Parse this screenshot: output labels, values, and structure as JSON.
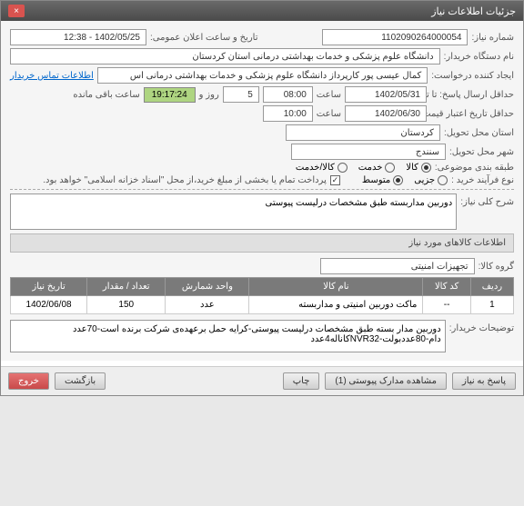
{
  "window": {
    "title": "جزئیات اطلاعات نیاز",
    "close": "×"
  },
  "fields": {
    "need_number_label": "شماره نیاز:",
    "need_number": "1102090264000054",
    "announce_label": "تاریخ و ساعت اعلان عمومی:",
    "announce_value": "1402/05/25 - 12:38",
    "buyer_label": "نام دستگاه خریدار:",
    "buyer_value": "دانشگاه علوم پزشکی و خدمات بهداشتی درمانی استان کردستان",
    "requester_label": "ایجاد کننده درخواست:",
    "requester_value": "کمال عیسی پور کارپرداز دانشگاه علوم پزشکی و خدمات بهداشتی درمانی اس",
    "contact_link": "اطلاعات تماس خریدار",
    "deadline_label": "حداقل ارسال پاسخ: تا تاریخ:",
    "deadline_date": "1402/05/31",
    "time_label": "ساعت",
    "deadline_time": "08:00",
    "days_value": "5",
    "days_label": "روز و",
    "countdown": "19:17:24",
    "remaining_label": "ساعت باقی مانده",
    "price_validity_label": "حداقل تاریخ اعتبار قیمت: تا تاریخ:",
    "price_validity_date": "1402/06/30",
    "price_validity_time": "10:00",
    "province_label": "استان محل تحویل:",
    "province_value": "کردستان",
    "city_label": "شهر محل تحویل:",
    "city_value": "سنندج",
    "category_label": "طبقه بندی موضوعی:",
    "cat_goods": "کالا",
    "cat_service": "خدمت",
    "cat_both": "کالا/خدمت",
    "purchase_type_label": "نوع فرآیند خرید :",
    "pt_small": "جزیی",
    "pt_medium": "متوسط",
    "payment_note": "پرداخت تمام یا بخشی از مبلغ خرید،از محل \"اسناد خزانه اسلامی\" خواهد بود.",
    "desc_label": "شرح کلی نیاز:",
    "desc_value": "دوربین مداربسته طبق مشخصات درلیست پیوستی",
    "items_header": "اطلاعات کالاهای مورد نیاز",
    "group_label": "گروه کالا:",
    "group_value": "تجهیزات امنیتی",
    "buyer_notes_label": "توضیحات خریدار:",
    "buyer_notes_value": "دوربین مدار بسته طبق مشخصات درلیست پیوستی-کرایه حمل برعهده‌ی شرکت برنده است-70عدد دام-80عددبولت-NVR32کاناله4عدد"
  },
  "table": {
    "headers": [
      "ردیف",
      "کد کالا",
      "نام کالا",
      "واحد شمارش",
      "تعداد / مقدار",
      "تاریخ نیاز"
    ],
    "rows": [
      {
        "idx": "1",
        "code": "--",
        "name": "ماکت دوربین امنیتی و مداربسته",
        "unit": "عدد",
        "qty": "150",
        "date": "1402/06/08"
      }
    ]
  },
  "buttons": {
    "respond": "پاسخ به نیاز",
    "attachments": "مشاهده مدارک پیوستی (1)",
    "print": "چاپ",
    "back": "بازگشت",
    "exit": "خروج"
  }
}
